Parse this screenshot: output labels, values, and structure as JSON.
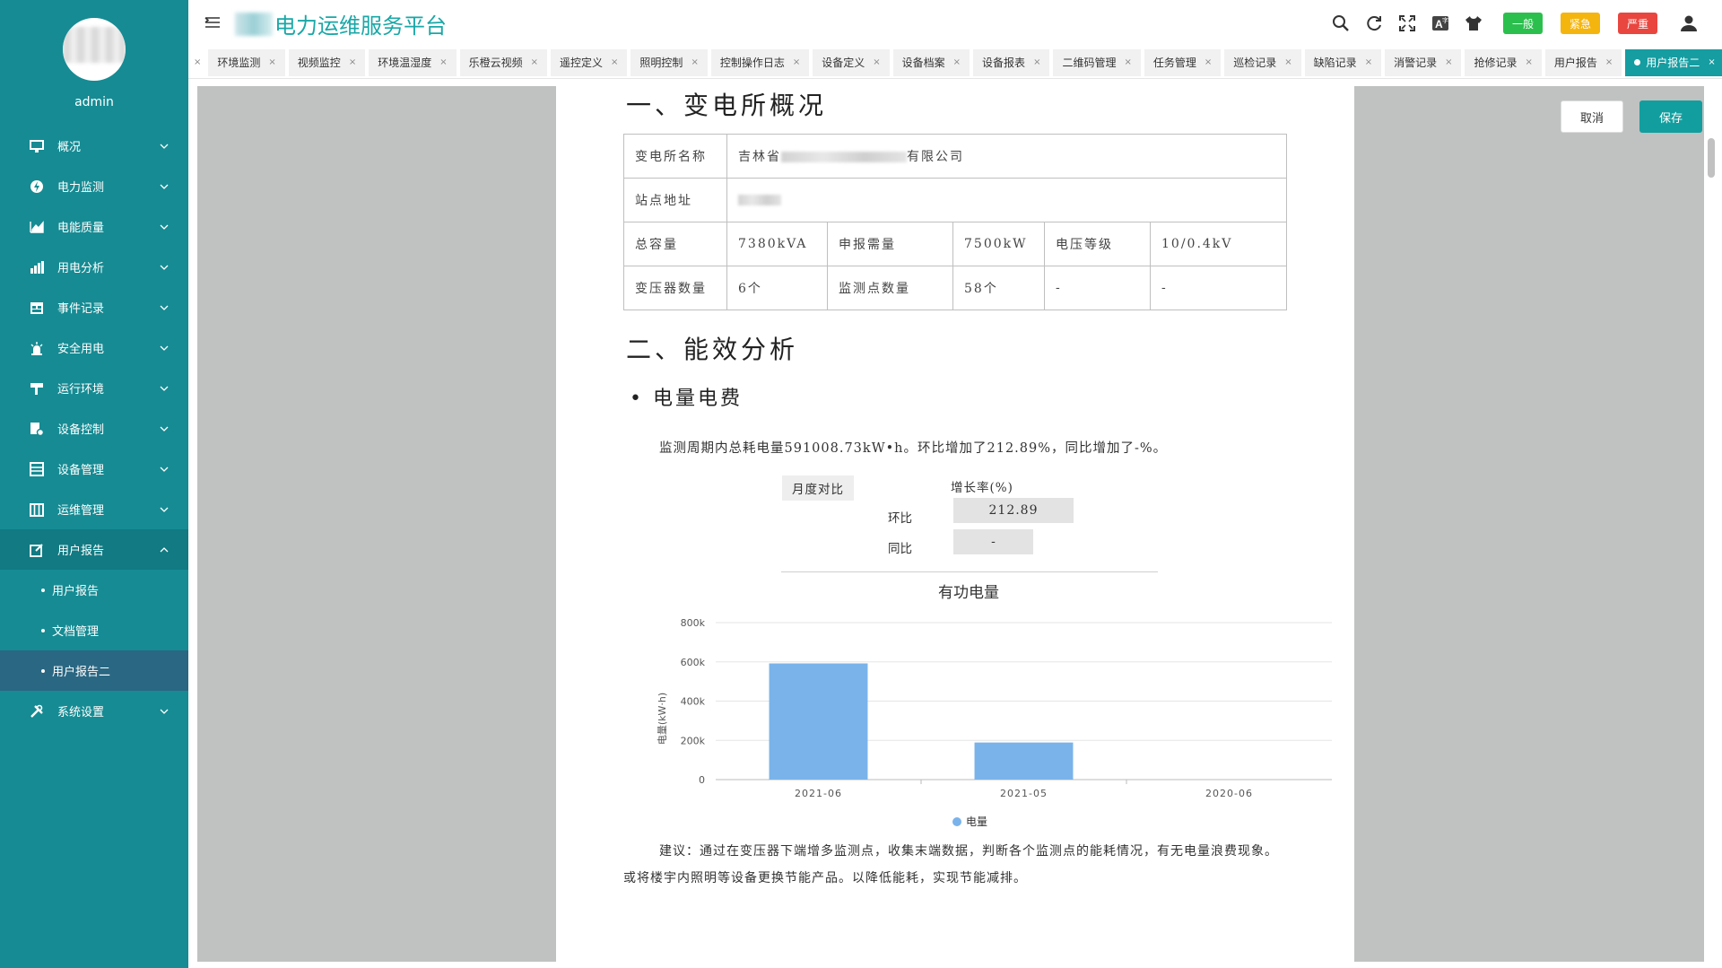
{
  "sidebar": {
    "username": "admin",
    "items": [
      {
        "label": "概况",
        "icon": "overview-icon"
      },
      {
        "label": "电力监测",
        "icon": "power-monitor-icon"
      },
      {
        "label": "电能质量",
        "icon": "power-quality-icon"
      },
      {
        "label": "用电分析",
        "icon": "bar-chart-icon"
      },
      {
        "label": "事件记录",
        "icon": "event-log-icon"
      },
      {
        "label": "安全用电",
        "icon": "alarm-light-icon"
      },
      {
        "label": "运行环境",
        "icon": "environment-icon"
      },
      {
        "label": "设备控制",
        "icon": "device-control-icon"
      },
      {
        "label": "设备管理",
        "icon": "device-manage-icon"
      },
      {
        "label": "运维管理",
        "icon": "ops-manage-icon"
      },
      {
        "label": "用户报告",
        "icon": "report-edit-icon"
      },
      {
        "label": "系统设置",
        "icon": "tools-icon"
      }
    ],
    "subitems": [
      "用户报告",
      "文档管理",
      "用户报告二"
    ]
  },
  "header": {
    "title": "电力运维服务平台",
    "badges": [
      "一般",
      "紧急",
      "严重"
    ]
  },
  "tabs": [
    "环境监测",
    "视频监控",
    "环境温湿度",
    "乐橙云视频",
    "遥控定义",
    "照明控制",
    "控制操作日志",
    "设备定义",
    "设备档案",
    "设备报表",
    "二维码管理",
    "任务管理",
    "巡检记录",
    "缺陷记录",
    "消警记录",
    "抢修记录",
    "用户报告",
    "用户报告二"
  ],
  "actions": {
    "cancel": "取消",
    "save": "保存"
  },
  "report": {
    "section1_title": "一、变电所概况",
    "table": {
      "name_label": "变电所名称",
      "name_prefix": "吉林省",
      "name_suffix": "有限公司",
      "address_label": "站点地址",
      "capacity_label": "总容量",
      "capacity": "7380kVA",
      "declared_label": "申报需量",
      "declared": "7500kW",
      "voltage_label": "电压等级",
      "voltage": "10/0.4kV",
      "transformer_label": "变压器数量",
      "transformers": "6个",
      "points_label": "监测点数量",
      "points": "58个",
      "dash1": "-",
      "dash2": "-"
    },
    "section2_title": "二、能效分析",
    "subsection": "• 电量电费",
    "summary": "监测周期内总耗电量591008.73kW•h。环比增加了212.89%，同比增加了-%。",
    "compare_label": "月度对比",
    "growth_header": "增长率(%)",
    "mom_label": "环比",
    "mom_value": "212.89",
    "yoy_label": "同比",
    "yoy_value": "-",
    "advice": "建议：通过在变压器下端增多监测点，收集末端数据，判断各个监测点的能耗情况，有无电量浪费现象。 或将楼宇内照明等设备更换节能产品。以降低能耗，实现节能减排。"
  },
  "chart_data": {
    "type": "bar",
    "title": "有功电量",
    "ylabel": "电量(kW·h)",
    "categories": [
      "2021-06",
      "2021-05",
      "2020-06"
    ],
    "series": [
      {
        "name": "电量",
        "values": [
          592000,
          189000,
          0
        ]
      }
    ],
    "ylim": [
      0,
      800000
    ],
    "yticks": [
      "0",
      "200k",
      "400k",
      "600k",
      "800k"
    ],
    "grid": true,
    "legend": "bottom",
    "color": "#7ab3ea"
  }
}
